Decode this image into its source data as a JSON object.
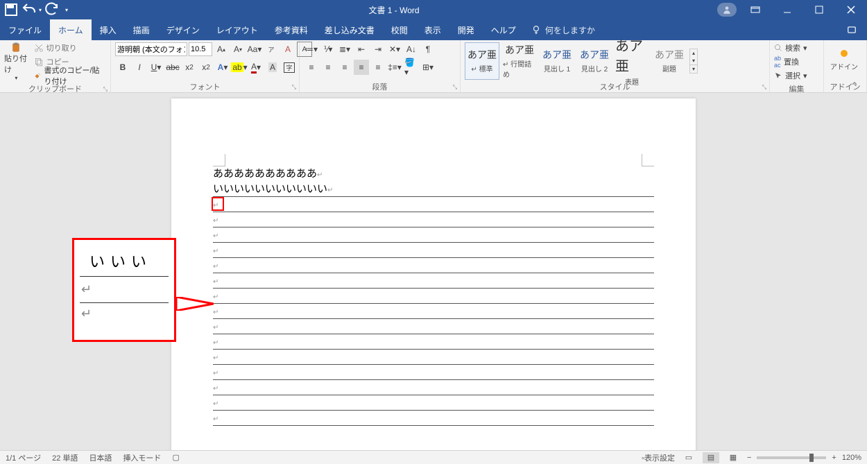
{
  "title": "文書 1  -  Word",
  "qat": {
    "save": "save",
    "undo": "undo",
    "redo": "redo"
  },
  "tabs": [
    "ファイル",
    "ホーム",
    "挿入",
    "描画",
    "デザイン",
    "レイアウト",
    "参考資料",
    "差し込み文書",
    "校閲",
    "表示",
    "開発",
    "ヘルプ"
  ],
  "active_tab_index": 1,
  "tellme": "何をしますか",
  "clipboard": {
    "paste": "貼り付け",
    "cut": "切り取り",
    "copy": "コピー",
    "formatpainter": "書式のコピー/貼り付け",
    "group": "クリップボード"
  },
  "font": {
    "name": "游明朝 (本文のフォン",
    "size": "10.5",
    "group": "フォント"
  },
  "paragraph": {
    "group": "段落"
  },
  "styles": {
    "group": "スタイル",
    "items": [
      {
        "preview": "あア亜",
        "name": "↵ 標準",
        "selected": true,
        "blue": false
      },
      {
        "preview": "あア亜",
        "name": "↵ 行間詰め",
        "selected": false,
        "blue": false
      },
      {
        "preview": "あア亜",
        "name": "見出し 1",
        "selected": false,
        "blue": true
      },
      {
        "preview": "あア亜",
        "name": "見出し 2",
        "selected": false,
        "blue": true
      },
      {
        "preview": "あア亜",
        "name": "表題",
        "selected": false,
        "blue": false,
        "big": true
      },
      {
        "preview": "あア亜",
        "name": "副題",
        "selected": false,
        "blue": false
      }
    ]
  },
  "editing": {
    "find": "検索",
    "replace": "置換",
    "select": "選択",
    "group": "編集"
  },
  "addin": {
    "label": "アドイン",
    "group": "アドイン"
  },
  "doc": {
    "line1": "ああああああああああ",
    "line2": "いいいいいいいいいいい"
  },
  "callout": {
    "text": "いいい"
  },
  "status": {
    "page": "1/1 ページ",
    "words": "22 単語",
    "lang": "日本語",
    "mode": "挿入モード",
    "display": "表示設定",
    "zoom": "120%"
  }
}
